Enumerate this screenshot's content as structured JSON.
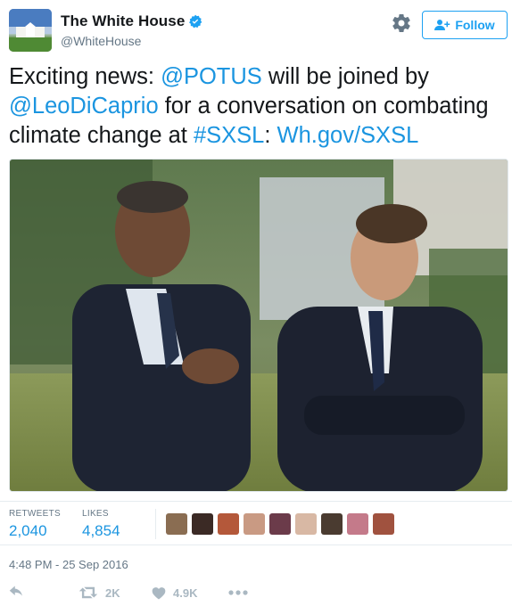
{
  "account": {
    "display_name": "The White House",
    "handle": "@WhiteHouse",
    "verified": true,
    "follow_label": "Follow"
  },
  "tweet": {
    "parts": [
      {
        "text": "Exciting news: ",
        "link": false
      },
      {
        "text": "@POTUS",
        "link": true
      },
      {
        "text": " will be joined by ",
        "link": false
      },
      {
        "text": "@LeoDiCaprio",
        "link": true
      },
      {
        "text": " for a conversation on combating climate change at ",
        "link": false
      },
      {
        "text": "#SXSL",
        "link": true
      },
      {
        "text": ": ",
        "link": false
      },
      {
        "text": "Wh.gov/SXSL",
        "link": true
      }
    ]
  },
  "stats": {
    "retweets_label": "RETWEETS",
    "retweets_value": "2,040",
    "likes_label": "LIKES",
    "likes_value": "4,854"
  },
  "timestamp": "4:48 PM - 25 Sep 2016",
  "actions": {
    "retweet_count": "2K",
    "like_count": "4.9K"
  },
  "colors": {
    "link": "#1b95e0",
    "follow_border": "#1da1f2",
    "meta_text": "#657786",
    "action_icon": "#aab8c2"
  },
  "liker_avatars": [
    "#8a6d52",
    "#3b2a25",
    "#b4583a",
    "#c99a83",
    "#6b3b4a",
    "#d8b8a4",
    "#4a3b30",
    "#c47a8a",
    "#a0523f"
  ]
}
